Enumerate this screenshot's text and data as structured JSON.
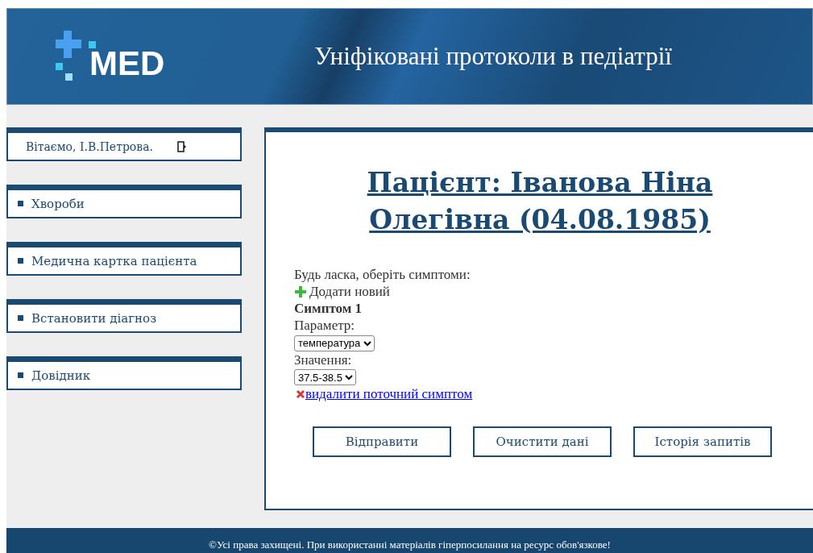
{
  "header": {
    "logo": "MED",
    "title": "Уніфіковані протоколи в педіатрії"
  },
  "sidebar": {
    "greeting": "Вітаємо, І.В.Петрова.",
    "items": [
      {
        "label": "Хвороби"
      },
      {
        "label": "Медична картка пацієнта"
      },
      {
        "label": "Встановити діагноз"
      },
      {
        "label": "Довідник"
      }
    ]
  },
  "main": {
    "heading": "Пацієнт: Іванова Ніна Олегівна (04.08.1985)",
    "prompt": "Будь ласка, оберіть симптоми:",
    "add_link": "Додати новий",
    "symptoms": [
      {
        "title": "Симптом 1",
        "parameter_label": "Параметр:",
        "parameter": "температура",
        "value_label": "Значення:",
        "value": "37.5-38.5",
        "remove_link": "видалити поточний симптом"
      }
    ],
    "buttons": [
      "Відправити",
      "Очистити дані",
      "Історія запитів"
    ]
  },
  "footer": "©Усі права захищені. При використанні матеріалів гіперпосилання на ресурс обов'язкове!"
}
